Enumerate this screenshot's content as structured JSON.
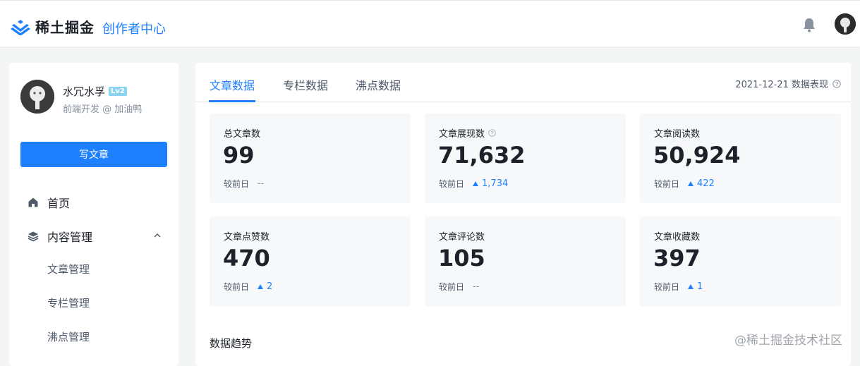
{
  "header": {
    "logo_text": "稀土掘金",
    "subtitle": "创作者中心",
    "accent": "#1e80ff"
  },
  "sidebar": {
    "user": {
      "name": "水冗水孚",
      "level": "Lv2",
      "desc": "前端开发 @ 加油鸭"
    },
    "write_button": "写文章",
    "nav": [
      {
        "label": "首页",
        "icon": "home-icon"
      },
      {
        "label": "内容管理",
        "icon": "layers-icon",
        "expanded": true
      }
    ],
    "sub_nav": [
      "文章管理",
      "专栏管理",
      "沸点管理"
    ]
  },
  "tabs": [
    {
      "label": "文章数据",
      "active": true
    },
    {
      "label": "专栏数据",
      "active": false
    },
    {
      "label": "沸点数据",
      "active": false
    }
  ],
  "date_info": "2021-12-21 数据表现",
  "compare_label": "较前日",
  "cards": [
    {
      "label": "总文章数",
      "value": "99",
      "delta": "--",
      "trend": "none",
      "help": false
    },
    {
      "label": "文章展现数",
      "value": "71,632",
      "delta": "1,734",
      "trend": "up",
      "help": true
    },
    {
      "label": "文章阅读数",
      "value": "50,924",
      "delta": "422",
      "trend": "up",
      "help": false
    },
    {
      "label": "文章点赞数",
      "value": "470",
      "delta": "2",
      "trend": "up",
      "help": false
    },
    {
      "label": "文章评论数",
      "value": "105",
      "delta": "--",
      "trend": "none",
      "help": false
    },
    {
      "label": "文章收藏数",
      "value": "397",
      "delta": "1",
      "trend": "up",
      "help": false
    }
  ],
  "trend_title": "数据趋势",
  "watermark": "@稀土掘金技术社区"
}
